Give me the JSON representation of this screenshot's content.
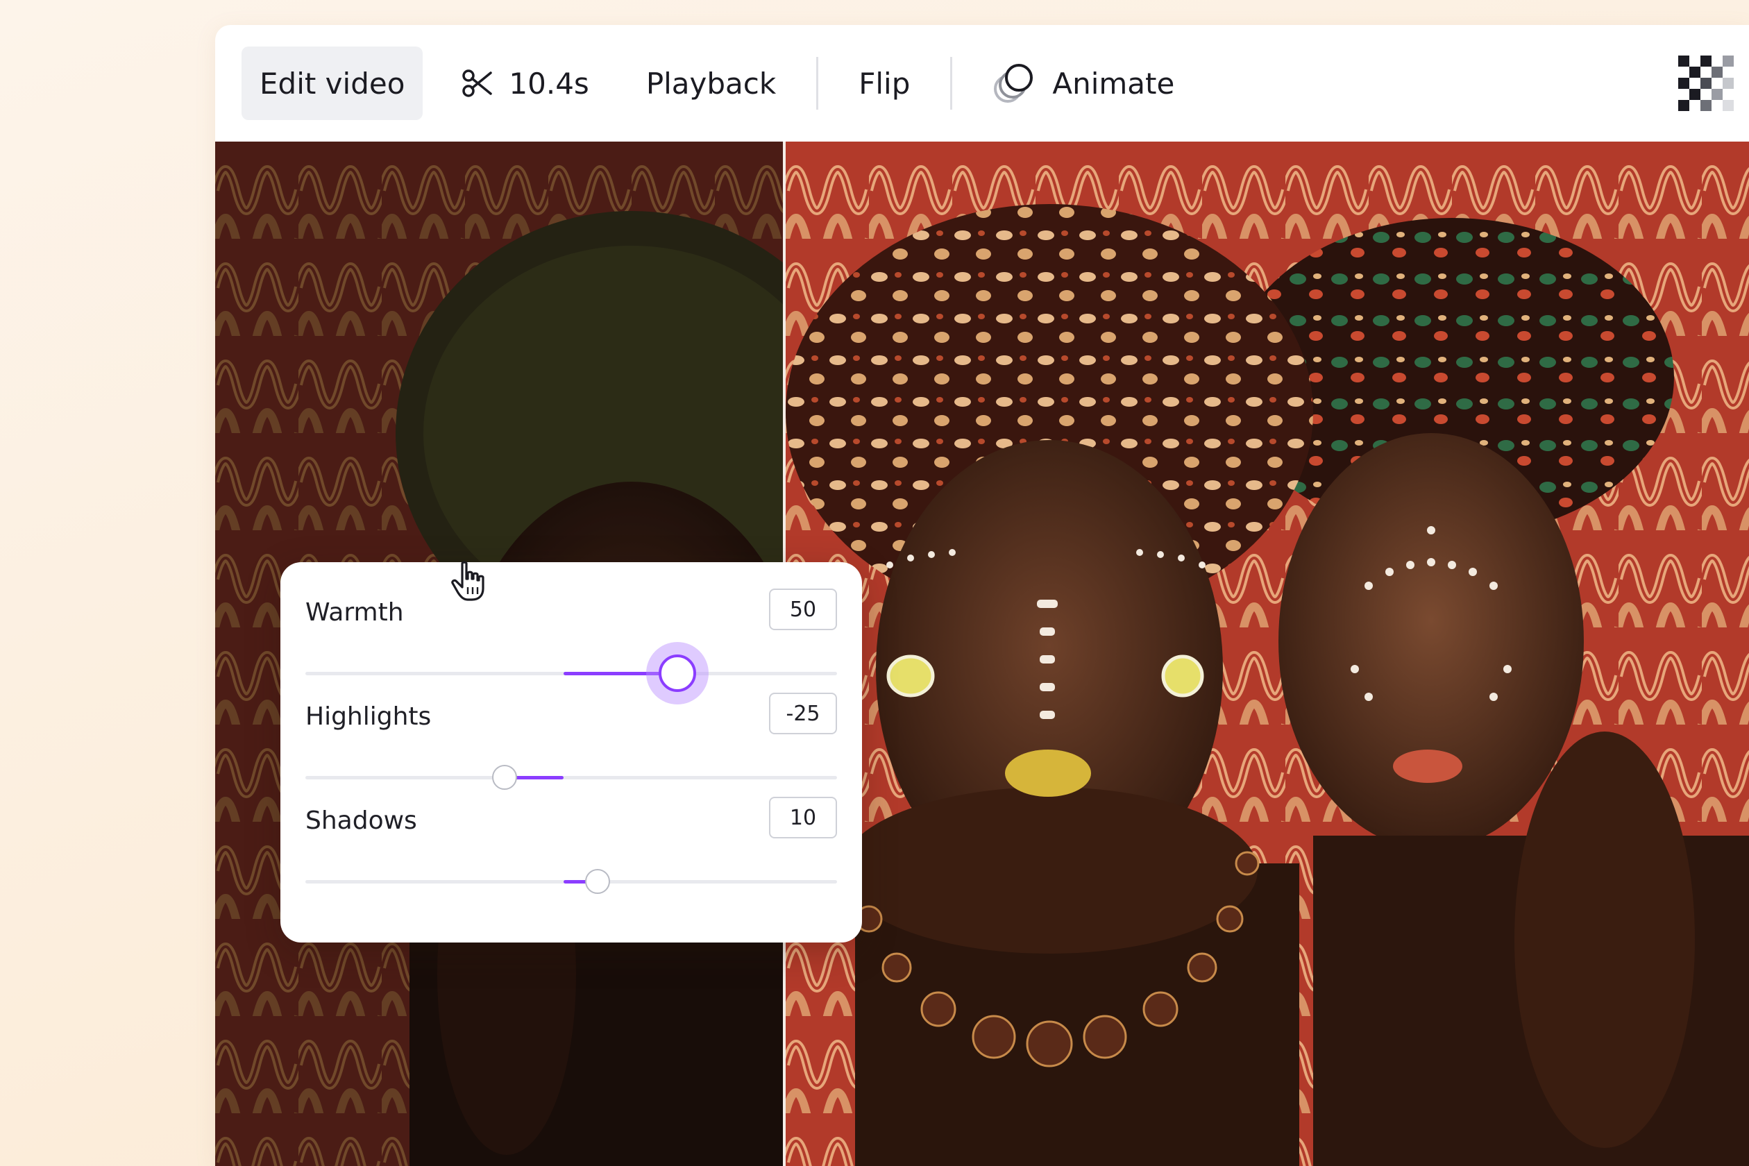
{
  "toolbar": {
    "edit_video": "Edit video",
    "trim_duration": "10.4s",
    "playback": "Playback",
    "flip": "Flip",
    "animate": "Animate"
  },
  "adjust_panel": {
    "sliders": [
      {
        "label": "Warmth",
        "value": "50",
        "fraction": 0.7
      },
      {
        "label": "Highlights",
        "value": "-25",
        "fraction": 0.375
      },
      {
        "label": "Shadows",
        "value": "10",
        "fraction": 0.55
      }
    ]
  },
  "colors": {
    "accent": "#8b3dff",
    "active_tab_bg": "#eff0f3",
    "page_bg": "#fbe9d2"
  }
}
